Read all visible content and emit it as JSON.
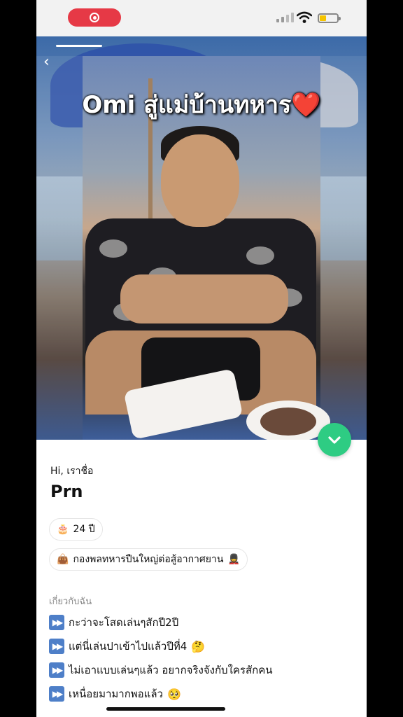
{
  "status_bar": {
    "recording": true,
    "signal_bars": 2,
    "battery": "low"
  },
  "story": {
    "caption_text": "Omi สู่แม่บ้านทหาร",
    "caption_emoji": "❤️",
    "back_glyph": "‹"
  },
  "profile": {
    "greeting": "Hi, เราชื่อ",
    "name": "Prn",
    "age_icon": "🎂",
    "age": "24 ปี",
    "job_icon": "👜",
    "job": "กองพลทหารปืนใหญ่ต่อสู้อากาศยาน",
    "job_emoji": "💂"
  },
  "about": {
    "heading": "เกี่ยวกับฉัน",
    "lines": [
      {
        "text": "กะว่าจะโสดเล่นๆสักปี2ปี",
        "emoji": ""
      },
      {
        "text": "แต่นี่เล่นปาเข้าไปแล้วปีที่4",
        "emoji": "🤔"
      },
      {
        "text": "ไม่เอาแบบเล่นๆแล้ว อยากจริงจังกับใครสักคน",
        "emoji": ""
      },
      {
        "text": "เหนื่อยมามากพอแล้ว",
        "emoji": "🥺"
      }
    ]
  },
  "colors": {
    "accent_green": "#2ecc83",
    "record_red": "#e63946",
    "ff_blue": "#4e7fc8"
  }
}
